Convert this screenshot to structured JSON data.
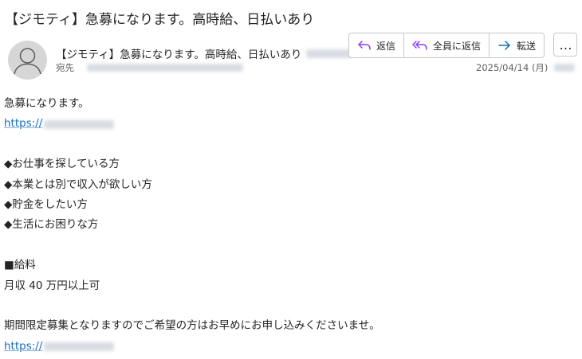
{
  "email": {
    "subject": "【ジモティ】急募になります。高時給、日払いあり",
    "sender_name": "【ジモティ】急募になります。高時給、日払いあり",
    "to_label": "宛先",
    "date": "2025/04/14 (月)"
  },
  "actions": {
    "reply": "返信",
    "reply_all": "全員に返信",
    "forward": "転送",
    "more": "…"
  },
  "body": {
    "line1": "急募になります。",
    "link1": "https://",
    "bullet1": "◆お仕事を探している方",
    "bullet2": "◆本業とは別で収入が欲しい方",
    "bullet3": "◆貯金をしたい方",
    "bullet4": "◆生活にお困りな方",
    "salary_heading": "■給料",
    "salary_value": "月収 40 万円以上可",
    "closing": "期間限定募集となりますのでご希望の方はお早めにお申し込みくださいませ。",
    "link2": "https://"
  },
  "colors": {
    "link": "#0f6cbd",
    "reply_icon": "#8a3ffc",
    "forward_icon": "#0f6cbd"
  }
}
